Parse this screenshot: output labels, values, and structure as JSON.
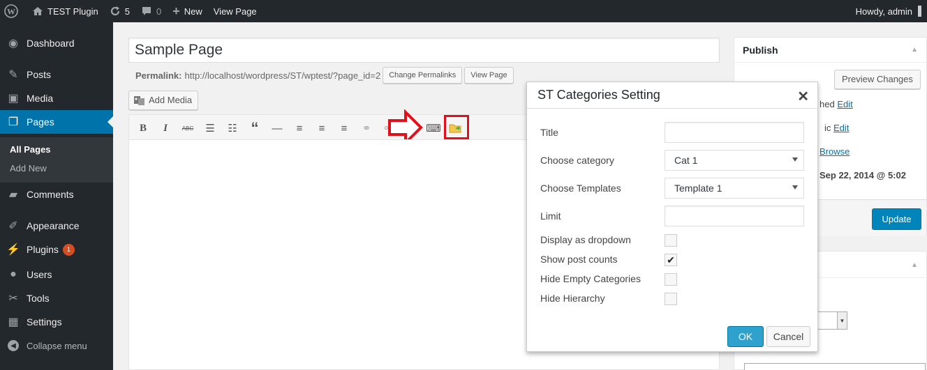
{
  "admin_bar": {
    "site_name": "TEST Plugin",
    "updates_count": "5",
    "comments_count": "0",
    "new_label": "New",
    "view_page_label": "View Page",
    "howdy": "Howdy, admin"
  },
  "sidebar": {
    "items": [
      {
        "label": "Dashboard",
        "icon": "dashboard-icon"
      },
      {
        "label": "Posts",
        "icon": "pin-icon"
      },
      {
        "label": "Media",
        "icon": "media-icon"
      },
      {
        "label": "Pages",
        "icon": "pages-icon"
      },
      {
        "label": "Comments",
        "icon": "comment-icon"
      },
      {
        "label": "Appearance",
        "icon": "brush-icon"
      },
      {
        "label": "Plugins",
        "icon": "plug-icon",
        "badge": "1"
      },
      {
        "label": "Users",
        "icon": "user-icon"
      },
      {
        "label": "Tools",
        "icon": "wrench-icon"
      },
      {
        "label": "Settings",
        "icon": "settings-icon"
      }
    ],
    "submenu": [
      "All Pages",
      "Add New"
    ],
    "collapse_label": "Collapse menu"
  },
  "editor": {
    "title_value": "Sample Page",
    "permalink_label": "Permalink:",
    "permalink_url": "http://localhost/wordpress/ST/wptest/?page_id=2",
    "change_permalinks": "Change Permalinks",
    "view_page": "View Page",
    "add_media": "Add Media"
  },
  "publish": {
    "title": "Publish",
    "preview_changes": "Preview Changes",
    "row1_text": "hed",
    "row1_link": "Edit",
    "row2_text": "ic",
    "row2_link": "Edit",
    "row3_link": "Browse",
    "row4_text": "Sep 22, 2014 @ 5:02",
    "update": "Update"
  },
  "modal": {
    "title": "ST Categories Setting",
    "fields": {
      "title_label": "Title",
      "category_label": "Choose category",
      "category_value": "Cat 1",
      "templates_label": "Choose Templates",
      "templates_value": "Template 1",
      "limit_label": "Limit",
      "dropdown_label": "Display as dropdown",
      "dropdown_checked": false,
      "post_counts_label": "Show post counts",
      "post_counts_checked": true,
      "hide_empty_label": "Hide Empty Categories",
      "hide_empty_checked": false,
      "hide_hierarchy_label": "Hide Hierarchy",
      "hide_hierarchy_checked": false
    },
    "ok": "OK",
    "cancel": "Cancel"
  },
  "colors": {
    "admin_dark": "#23282d",
    "accent_blue": "#0073aa",
    "highlight_red": "#e2101a",
    "plugin_badge": "#d54e21"
  }
}
